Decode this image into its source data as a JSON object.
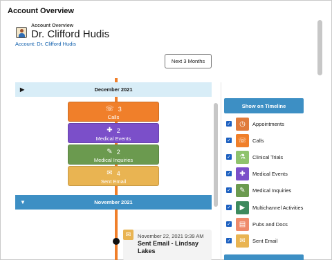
{
  "window": {
    "title": "Account Overview"
  },
  "header": {
    "eyebrow": "Account Overview",
    "name": "Dr. Clifford Hudis",
    "account_link": "Account: Dr. Clifford Hudis"
  },
  "controls": {
    "next_button": "Next 3 Months"
  },
  "timeline": {
    "months": [
      {
        "label": "December 2021",
        "expanded": false
      },
      {
        "label": "November 2021",
        "expanded": true
      }
    ],
    "summary": [
      {
        "count": "3",
        "label": "Calls",
        "color": "#f07f2a",
        "icon": "phone-icon"
      },
      {
        "count": "2",
        "label": "Medical Events",
        "color": "#7b4fc9",
        "icon": "medical-event-icon"
      },
      {
        "count": "2",
        "label": "Medical Inquiries",
        "color": "#6b9a4f",
        "icon": "inquiry-icon"
      },
      {
        "count": "4",
        "label": "Sent Email",
        "color": "#e9b452",
        "icon": "envelope-icon"
      }
    ],
    "activity": {
      "timestamp": "November 22, 2021 9:39 AM",
      "title": "Sent Email - Lindsay Lakes",
      "icon": "envelope-icon"
    }
  },
  "filters": {
    "button_label": "Show on Timeline",
    "items": [
      {
        "label": "Appointments",
        "checked": true,
        "color": "#e07b3c",
        "icon": "clock-icon"
      },
      {
        "label": "Calls",
        "checked": true,
        "color": "#f07f2a",
        "icon": "phone-icon"
      },
      {
        "label": "Clinical Trials",
        "checked": true,
        "color": "#8fc36d",
        "icon": "clinical-trial-icon"
      },
      {
        "label": "Medical Events",
        "checked": true,
        "color": "#7b4fc9",
        "icon": "medical-event-icon"
      },
      {
        "label": "Medical Inquiries",
        "checked": true,
        "color": "#6b9a4f",
        "icon": "inquiry-icon"
      },
      {
        "label": "Multichannel Activities",
        "checked": true,
        "color": "#3d8a5e",
        "icon": "multichannel-icon"
      },
      {
        "label": "Pubs and Docs",
        "checked": true,
        "color": "#ef8a6a",
        "icon": "document-icon"
      },
      {
        "label": "Sent Email",
        "checked": true,
        "color": "#e9b452",
        "icon": "envelope-icon"
      }
    ]
  }
}
